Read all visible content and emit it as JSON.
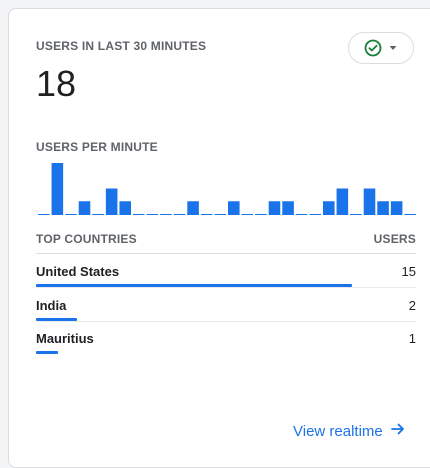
{
  "card": {
    "title": "USERS IN LAST 30 MINUTES",
    "users_count": "18",
    "status_icon": "check-circle-icon",
    "dropdown_icon": "caret-down-icon",
    "accent_color": "#1a73e8",
    "status_color": "#188038"
  },
  "per_minute": {
    "label": "USERS PER MINUTE",
    "chart_data": {
      "type": "bar",
      "values": [
        0,
        4,
        0,
        1,
        0,
        2,
        1,
        0,
        0,
        0,
        0,
        1,
        0,
        0,
        1,
        0,
        0,
        1,
        1,
        0,
        0,
        1,
        2,
        0,
        2,
        1,
        1,
        0
      ],
      "ylim": [
        0,
        4
      ]
    }
  },
  "countries": {
    "header_label": "TOP COUNTRIES",
    "header_value": "USERS",
    "max_value": 15,
    "rows": [
      {
        "name": "United States",
        "value": "15",
        "fraction": 1.0
      },
      {
        "name": "India",
        "value": "2",
        "fraction": 0.13
      },
      {
        "name": "Mauritius",
        "value": "1",
        "fraction": 0.07
      }
    ]
  },
  "footer": {
    "link_label": "View realtime",
    "link_icon": "arrow-right-icon"
  }
}
